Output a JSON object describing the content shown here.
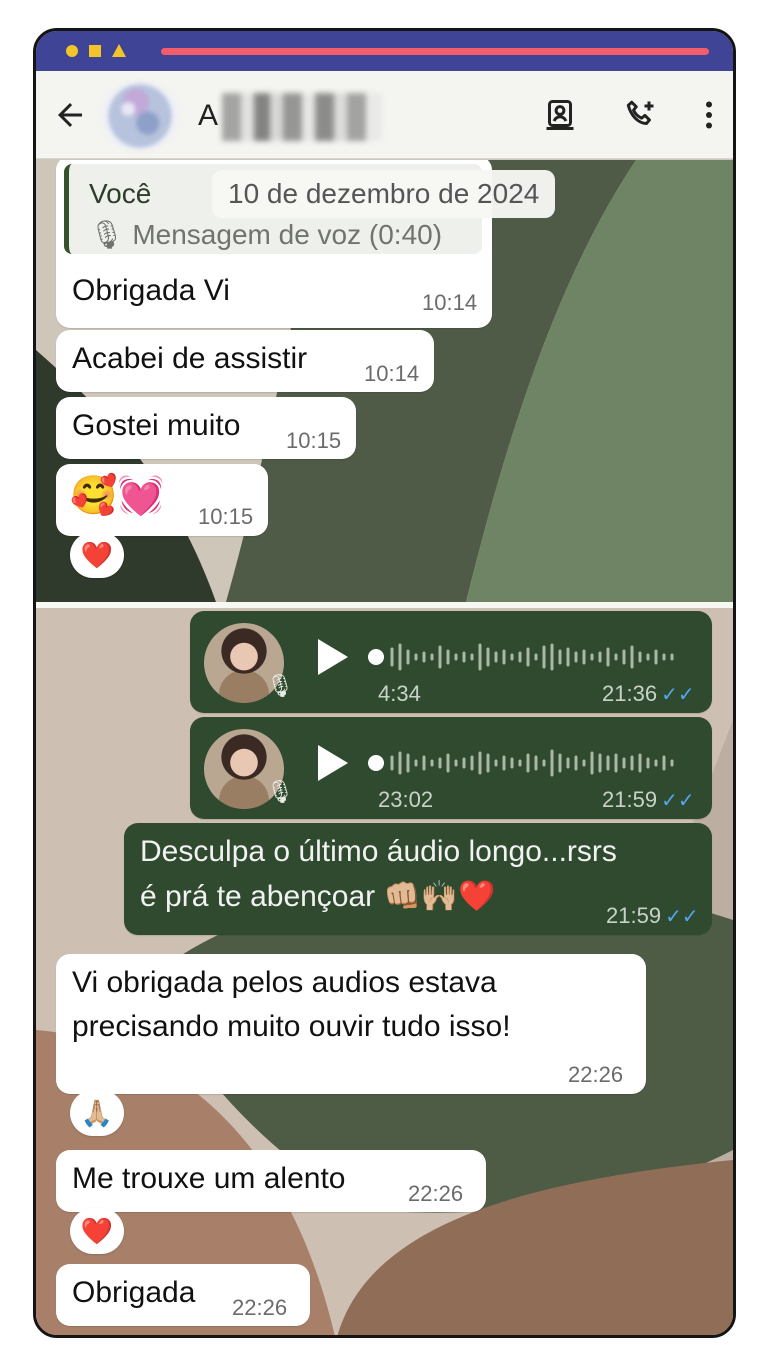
{
  "status_bar": {
    "colors": {
      "bar": "#3f4496",
      "shapes": "#f3c52a",
      "progress": "#f25d6c"
    }
  },
  "header": {
    "contact_name_visible": "A",
    "icons": [
      "back-arrow-icon",
      "contacts-icon",
      "add-call-icon",
      "more-vert-icon"
    ]
  },
  "chat": {
    "date_chip": "10 de dezembro de 2024",
    "quoted": {
      "sender": "Você",
      "body": "Mensagem de voz (0:40)",
      "icon": "mic-icon"
    },
    "incoming_top": [
      {
        "text": "Obrigada Vi",
        "time": "10:14"
      },
      {
        "text": "Acabei de assistir",
        "time": "10:14"
      },
      {
        "text": "Gostei muito",
        "time": "10:15"
      },
      {
        "text": "🥰💓",
        "time": "10:15",
        "reaction": "❤️"
      }
    ],
    "outgoing_audio": [
      {
        "duration": "4:34",
        "time": "21:36",
        "status": "read"
      },
      {
        "duration": "23:02",
        "time": "21:59",
        "status": "read"
      }
    ],
    "outgoing_text": {
      "line1": "Desculpa o último áudio longo...rsrs",
      "line2": "é prá te abençoar 👊🏼🙌🏼❤️",
      "time": "21:59",
      "ticks": "✓✓"
    },
    "incoming_bottom": [
      {
        "line1": "Vi obrigada pelos audios estava",
        "line2": "precisando muito ouvir tudo isso!",
        "time": "22:26",
        "reaction": "🙏🏼"
      },
      {
        "text": "Me trouxe um alento",
        "time": "22:26",
        "reaction": "❤️"
      },
      {
        "text": "Obrigada",
        "time": "22:26"
      }
    ],
    "colors": {
      "incoming": "#ffffff",
      "outgoing": "#2f4a2f",
      "read_ticks": "#53a6f0"
    }
  }
}
